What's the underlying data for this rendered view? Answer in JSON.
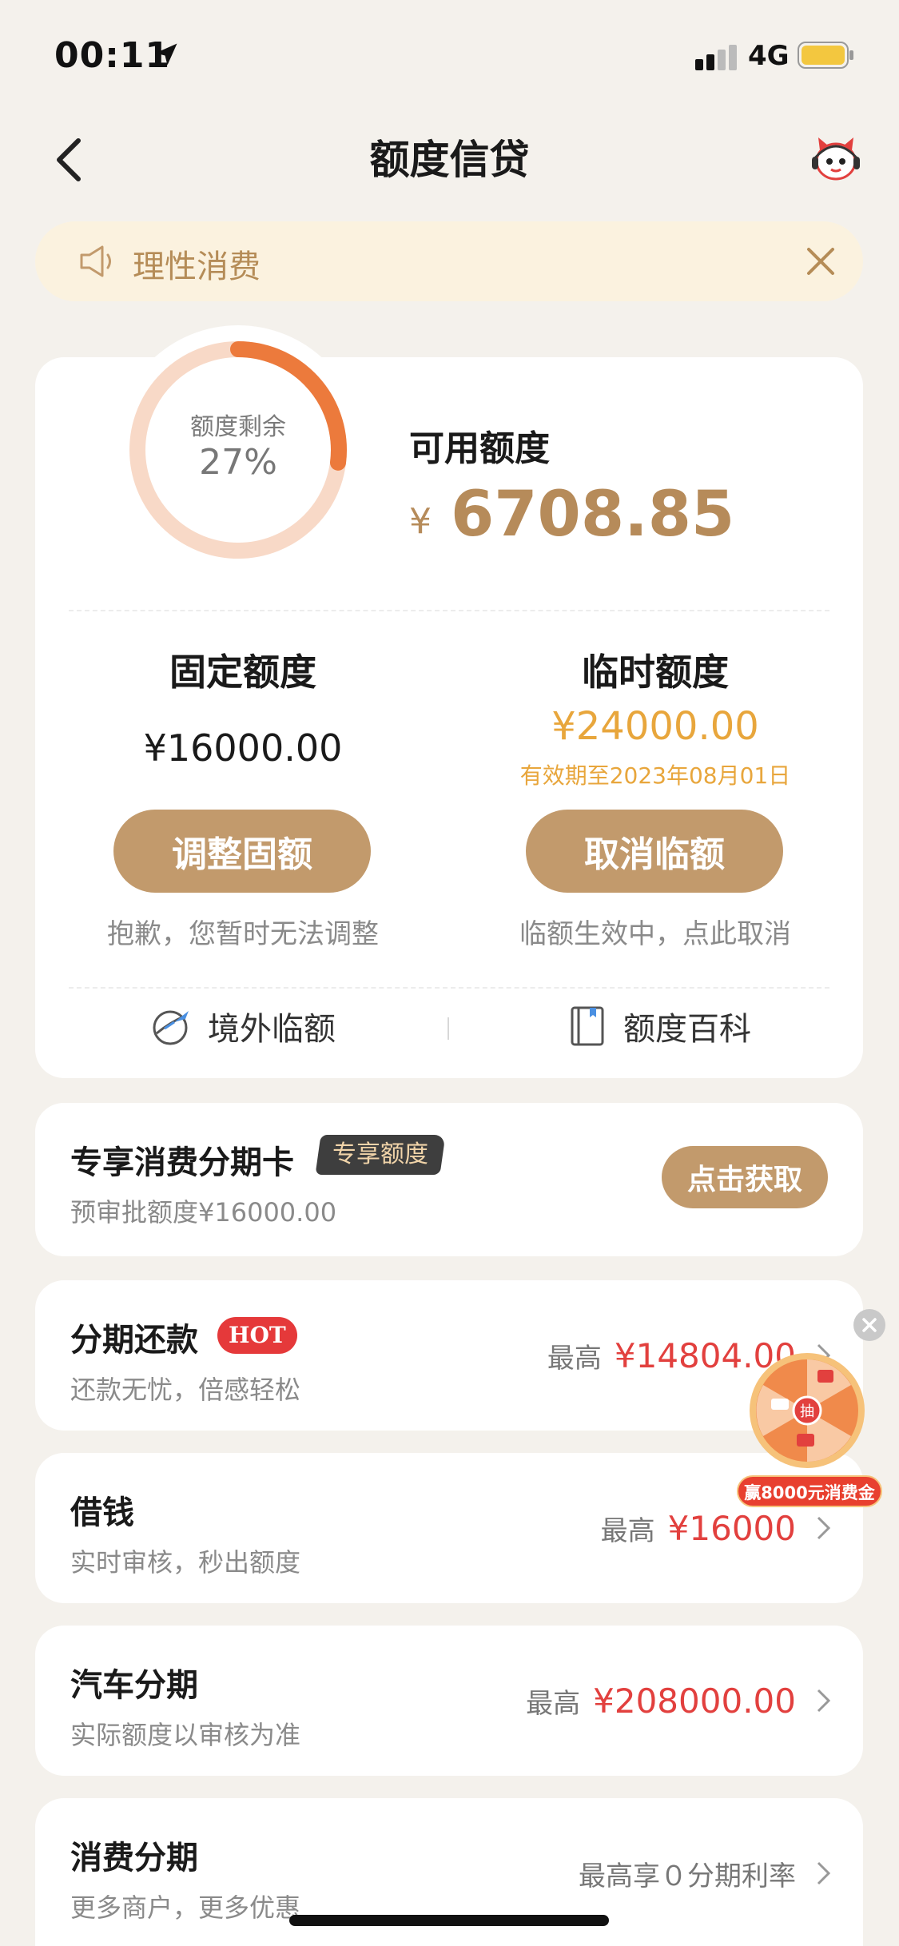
{
  "status_bar": {
    "time": "00:11",
    "network": "4G"
  },
  "nav": {
    "title": "额度信贷"
  },
  "notice": {
    "text": "理性消费"
  },
  "quota": {
    "ring_label": "额度剩余",
    "ring_percent_text": "27%",
    "ring_fraction": 0.27,
    "available_label": "可用额度",
    "currency": "¥",
    "available_amount": "6708.85",
    "fixed": {
      "title": "固定额度",
      "amount": "¥16000.00",
      "button": "调整固额",
      "note": "抱歉，您暂时无法调整"
    },
    "temporary": {
      "title": "临时额度",
      "amount": "¥24000.00",
      "valid_until": "有效期至2023年08月01日",
      "button": "取消临额",
      "note": "临额生效中，点此取消"
    },
    "links": {
      "overseas": "境外临额",
      "wiki": "额度百科"
    }
  },
  "exclusive_card": {
    "title": "专享消费分期卡",
    "tag": "专享额度",
    "subtitle": "预审批额度¥16000.00",
    "button": "点击获取"
  },
  "items": [
    {
      "title": "分期还款",
      "badge": "HOT",
      "subtitle": "还款无忧，倍感轻松",
      "prefix": "最高",
      "amount": "¥14804.00"
    },
    {
      "title": "借钱",
      "subtitle": "实时审核，秒出额度",
      "prefix": "最高",
      "amount": "¥16000"
    },
    {
      "title": "汽车分期",
      "subtitle": "实际额度以审核为准",
      "prefix": "最高",
      "amount": "¥208000.00"
    },
    {
      "title": "消费分期",
      "subtitle": "更多商户，更多优惠",
      "rate_text": "最高享０分期利率"
    }
  ],
  "floating_promo": {
    "center_label": "抽",
    "banner": "赢8000元消费金"
  },
  "colors": {
    "accent": "#c29a6c",
    "ring": "#ec7a3c",
    "ring_track": "#f8d9c7",
    "red": "#e2403e",
    "gold": "#e8a63c"
  }
}
